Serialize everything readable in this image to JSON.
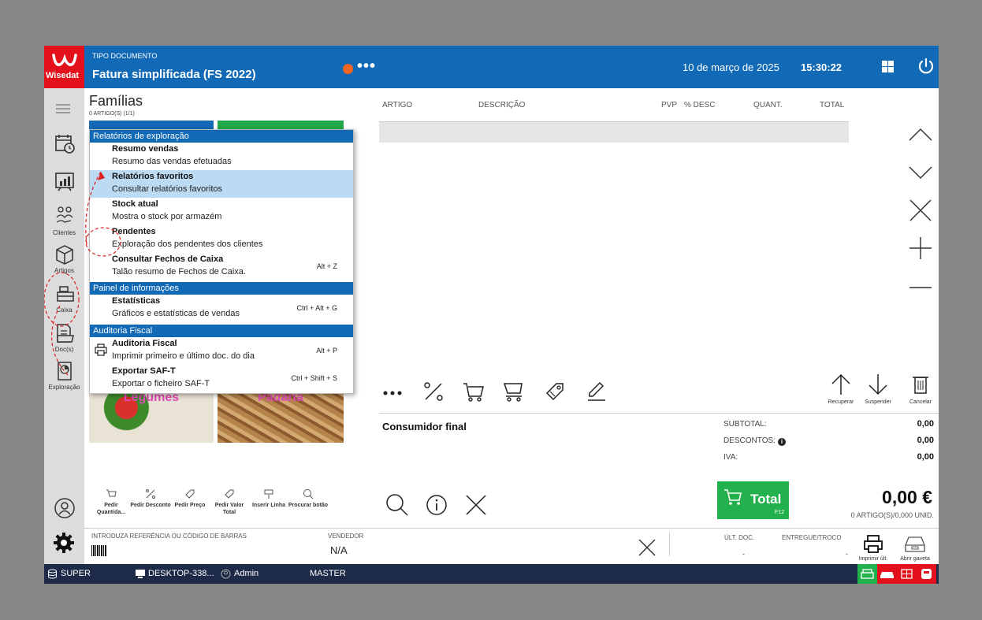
{
  "header": {
    "brand": "Wisedat",
    "doc_caption": "TIPO DOCUMENTO",
    "doc_title": "Fatura simplificada (FS 2022)",
    "date": "10 de março de 2025",
    "time": "15:30:22"
  },
  "rail": {
    "clientes": "Clientes",
    "artigos": "Artigos",
    "caixa": "Caixa",
    "docs": "Doc(s)",
    "exploracao": "Exploração"
  },
  "families": {
    "title": "Famílias",
    "subtitle": "0 ARTIGO(S) (1/1)",
    "tiles": [
      "Legumes",
      "Padaria"
    ]
  },
  "menu": {
    "sections": [
      "Relatórios de exploração",
      "Painel de informações",
      "Auditoria Fiscal"
    ],
    "items": [
      {
        "title": "Resumo vendas",
        "desc": "Resumo das vendas efetuadas",
        "shortcut": ""
      },
      {
        "title": "Relatórios favoritos",
        "desc": "Consultar relatórios favoritos",
        "shortcut": ""
      },
      {
        "title": "Stock atual",
        "desc": "Mostra o stock por armazém",
        "shortcut": ""
      },
      {
        "title": "Pendentes",
        "desc": "Exploração dos pendentes dos clientes",
        "shortcut": ""
      },
      {
        "title": "Consultar Fechos de Caixa",
        "desc": "Talão resumo de Fechos de Caixa.",
        "shortcut": "Alt + Z"
      },
      {
        "title": "Estatísticas",
        "desc": "Gráficos e estatísticas de vendas",
        "shortcut": "Ctrl + Alt + G"
      },
      {
        "title": "Auditoria Fiscal",
        "desc": "Imprimir primeiro e último doc. do dia",
        "shortcut": "Alt + P"
      },
      {
        "title": "Exportar SAF-T",
        "desc": "Exportar o ficheiro SAF-T",
        "shortcut": "Ctrl + Shift + S"
      }
    ]
  },
  "grid": {
    "columns": [
      "ARTIGO",
      "DESCRIÇÃO",
      "PVP",
      "% DESC",
      "QUANT.",
      "TOTAL"
    ]
  },
  "family_actions": [
    "Pedir Quantida...",
    "Pedir Desconto",
    "Pedir Preço",
    "Pedir Valor Total",
    "Inserir Linha",
    "Procurar botão"
  ],
  "line_actions": {
    "recuperar": "Recuperar",
    "suspender": "Suspender",
    "cancelar": "Cancelar"
  },
  "totals": {
    "customer": "Consumidor final",
    "subtotal_label": "SUBTOTAL:",
    "subtotal": "0,00",
    "descontos_label": "DESCONTOS:",
    "descontos": "0,00",
    "iva_label": "IVA:",
    "iva": "0,00",
    "total_label": "Total",
    "total_key": "F12",
    "amount": "0,00 €",
    "units": "0 ARTIGO(S)/0,000 UNID."
  },
  "entry": {
    "caption": "INTRODUZA REFERÊNCIA OU CÓDIGO DE BARRAS",
    "vendedor_label": "VENDEDOR",
    "vendedor": "N/A",
    "ult_doc_label": "ÚLT. DOC.",
    "ult_doc": "-",
    "entregue_label": "ENTREGUE/TROCO",
    "entregue": "-",
    "imprimir": "Imprimir últ.",
    "gaveta": "Abrir gaveta"
  },
  "status": {
    "db": "SUPER",
    "machine": "DESKTOP-338...",
    "user": "Admin",
    "profile": "MASTER"
  },
  "colors": {
    "header_blue": "#1269b5",
    "brand_red": "#e3111b",
    "total_green": "#22b14c",
    "status_navy": "#1d2b49",
    "selection": "#bcdaf2"
  }
}
